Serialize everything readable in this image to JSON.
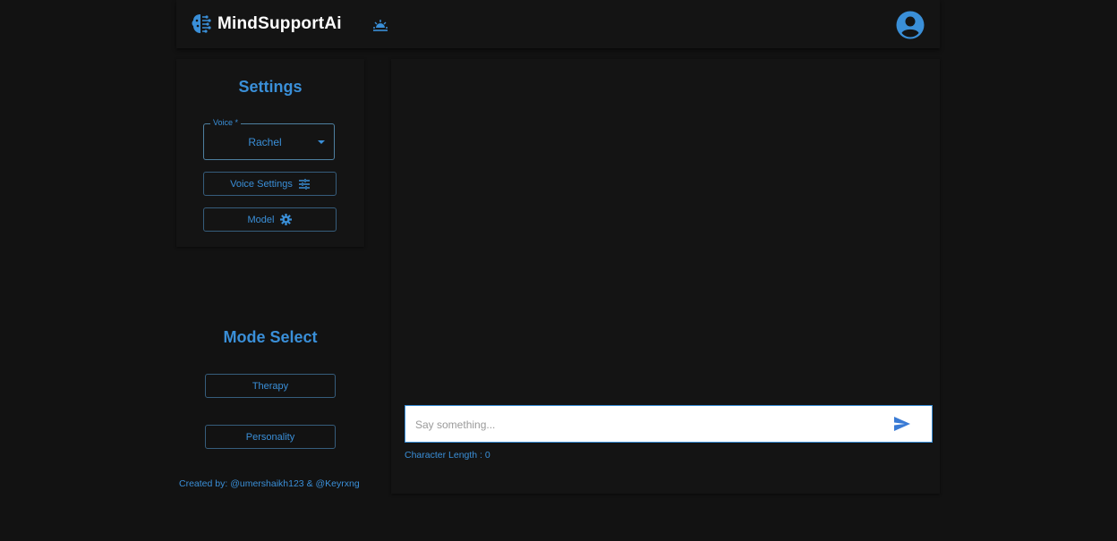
{
  "header": {
    "brand_name": "MindSupportAi",
    "brand_icon": "brain-circuit-icon",
    "theme_icon": "sunrise-icon",
    "avatar_icon": "account-circle-icon"
  },
  "settings": {
    "title": "Settings",
    "voice_label": "Voice *",
    "voice_value": "Rachel",
    "voice_settings_label": "Voice Settings",
    "voice_settings_icon": "tune-icon",
    "model_label": "Model",
    "model_icon": "gear-icon"
  },
  "mode": {
    "title": "Mode Select",
    "options": [
      "Therapy",
      "Personality"
    ]
  },
  "footer": {
    "credit": "Created by: @umershaikh123 & @Keyrxng"
  },
  "chat": {
    "placeholder": "Say something...",
    "value": "",
    "send_icon": "send-icon",
    "char_length_text": "Character Length : 0"
  },
  "colors": {
    "background": "#121212",
    "panel": "#141414",
    "accent": "#3a8fd8",
    "brand_text": "#ffffff"
  }
}
